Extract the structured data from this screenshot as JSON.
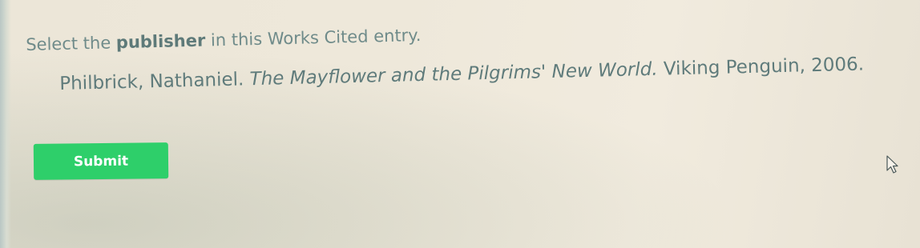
{
  "question": {
    "prefix": "Select the ",
    "bold": "publisher",
    "suffix": " in this Works Cited entry."
  },
  "citation": {
    "author": "Philbrick, Nathaniel.",
    "title": "The Mayflower and the Pilgrims' New World.",
    "publisher": "Viking Penguin,",
    "year": "2006."
  },
  "submit_button": {
    "label": "Submit",
    "color": "#2ecf6a"
  },
  "cursor": {
    "icon": "arrow-cursor-icon"
  }
}
